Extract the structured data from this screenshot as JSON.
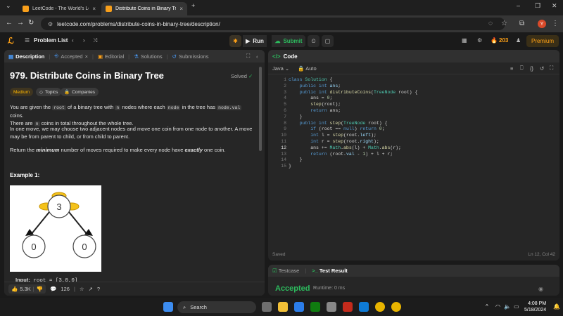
{
  "browser": {
    "tabs": [
      {
        "title": "LeetCode - The World's Leadin"
      },
      {
        "title": "Distribute Coins in Binary Tree"
      }
    ],
    "url": "leetcode.com/problems/distribute-coins-in-binary-tree/description/"
  },
  "nav": {
    "problem_list": "Problem List",
    "run": "Run",
    "submit": "Submit",
    "streak": "203",
    "premium": "Premium"
  },
  "left": {
    "tabs": [
      "Description",
      "Accepted",
      "Editorial",
      "Solutions",
      "Submissions"
    ],
    "title": "979. Distribute Coins in Binary Tree",
    "solved": "Solved",
    "chips": {
      "difficulty": "Medium",
      "topics": "Topics",
      "companies": "Companies"
    },
    "para1": {
      "a": "You are given the ",
      "code1": "root",
      "b": " of a binary tree with ",
      "code2": "n",
      "c": " nodes where each ",
      "code3": "node",
      "d": " in the tree has ",
      "code4": "node.val",
      "e": " coins.",
      "f": "There are ",
      "code5": "n",
      "g": " coins in total throughout the whole tree."
    },
    "para2": "In one move, we may choose two adjacent nodes and move one coin from one node to another. A move may be from parent to child, or from child to parent.",
    "para3": {
      "a": "Return the ",
      "b": "minimum",
      "c": " number of moves required to make every node have ",
      "d": "exactly",
      "e": " one coin."
    },
    "example_heading": "Example 1:",
    "tree": {
      "root": "3",
      "left": "0",
      "right": "0"
    },
    "input_label": "Input:",
    "input_value": "root = [3,0,0]",
    "likes": "5.3K",
    "comments": "126"
  },
  "code": {
    "header": "Code",
    "language": "Java",
    "mode": "Auto",
    "line_numbers": [
      "1",
      "2",
      "3",
      "4",
      "5",
      "6",
      "7",
      "8",
      "9",
      "10",
      "11",
      "12",
      "13",
      "14",
      "15"
    ],
    "saved": "Saved",
    "cursor": "Ln 12, Col 42"
  },
  "test": {
    "tabs": [
      "Testcase",
      "Test Result"
    ],
    "status": "Accepted",
    "runtime": "Runtime: 0 ms"
  },
  "taskbar": {
    "search": "Search",
    "time": "4:08 PM",
    "date": "5/18/2024"
  },
  "colors": {
    "accent": "#ffa116",
    "success": "#2cbb5d",
    "bg": "#1a1a1a",
    "panel": "#262626"
  }
}
